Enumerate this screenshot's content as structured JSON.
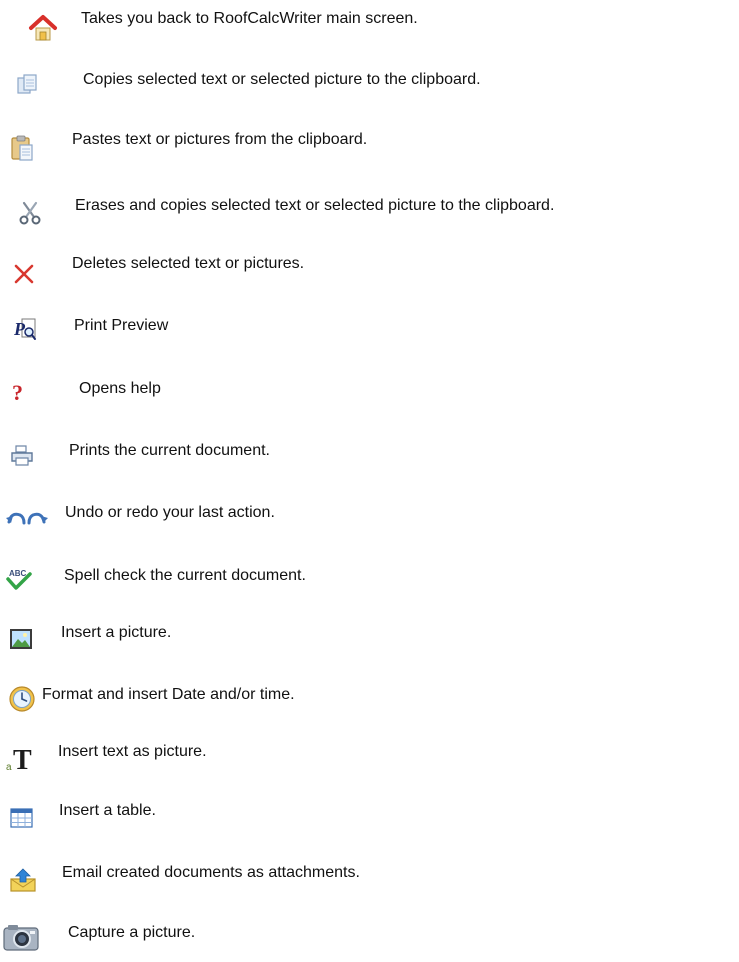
{
  "items": [
    {
      "icon": "home-icon",
      "label": "Takes you back to RoofCalcWriter main screen."
    },
    {
      "icon": "copy-icon",
      "label": "Copies selected text or selected picture to the clipboard."
    },
    {
      "icon": "paste-icon",
      "label": "Pastes text or pictures from the clipboard."
    },
    {
      "icon": "cut-icon",
      "label": "Erases and copies selected text or selected picture to the clipboard."
    },
    {
      "icon": "delete-icon",
      "label": "Deletes selected text or pictures."
    },
    {
      "icon": "print-preview-icon",
      "label": "Print Preview"
    },
    {
      "icon": "help-icon",
      "label": "Opens help"
    },
    {
      "icon": "print-icon",
      "label": "Prints the current document."
    },
    {
      "icon": "undo-redo-icon",
      "label": "Undo or redo your last action."
    },
    {
      "icon": "spell-check-icon",
      "label": "Spell check the current document."
    },
    {
      "icon": "insert-picture-icon",
      "label": "Insert a picture."
    },
    {
      "icon": "date-time-icon",
      "label": "Format and insert Date and/or time."
    },
    {
      "icon": "text-as-picture-icon",
      "label": "Insert text as picture."
    },
    {
      "icon": "insert-table-icon",
      "label": "Insert a table."
    },
    {
      "icon": "email-icon",
      "label": "Email created documents as attachments."
    },
    {
      "icon": "camera-icon",
      "label": "Capture a picture."
    }
  ]
}
